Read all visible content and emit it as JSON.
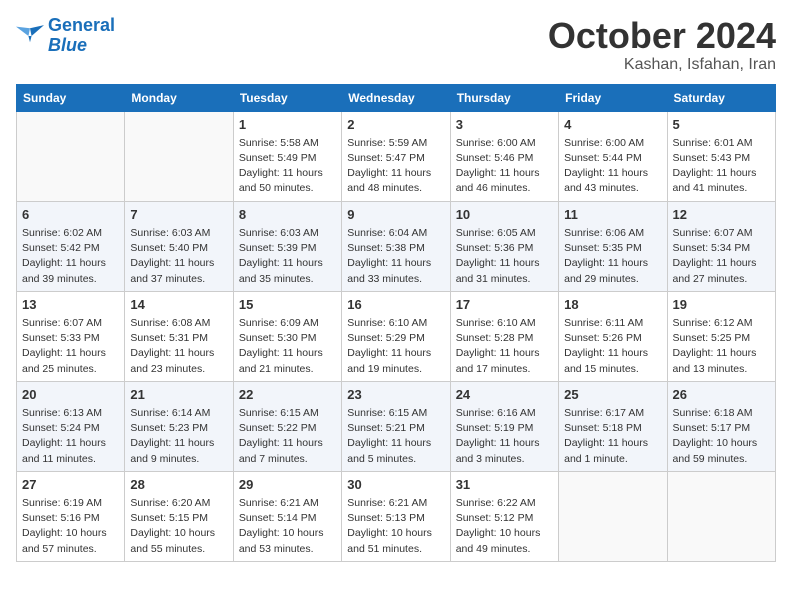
{
  "header": {
    "logo_line1": "General",
    "logo_line2": "Blue",
    "month": "October 2024",
    "location": "Kashan, Isfahan, Iran"
  },
  "weekdays": [
    "Sunday",
    "Monday",
    "Tuesday",
    "Wednesday",
    "Thursday",
    "Friday",
    "Saturday"
  ],
  "weeks": [
    [
      {
        "day": "",
        "info": ""
      },
      {
        "day": "",
        "info": ""
      },
      {
        "day": "1",
        "info": "Sunrise: 5:58 AM\nSunset: 5:49 PM\nDaylight: 11 hours and 50 minutes."
      },
      {
        "day": "2",
        "info": "Sunrise: 5:59 AM\nSunset: 5:47 PM\nDaylight: 11 hours and 48 minutes."
      },
      {
        "day": "3",
        "info": "Sunrise: 6:00 AM\nSunset: 5:46 PM\nDaylight: 11 hours and 46 minutes."
      },
      {
        "day": "4",
        "info": "Sunrise: 6:00 AM\nSunset: 5:44 PM\nDaylight: 11 hours and 43 minutes."
      },
      {
        "day": "5",
        "info": "Sunrise: 6:01 AM\nSunset: 5:43 PM\nDaylight: 11 hours and 41 minutes."
      }
    ],
    [
      {
        "day": "6",
        "info": "Sunrise: 6:02 AM\nSunset: 5:42 PM\nDaylight: 11 hours and 39 minutes."
      },
      {
        "day": "7",
        "info": "Sunrise: 6:03 AM\nSunset: 5:40 PM\nDaylight: 11 hours and 37 minutes."
      },
      {
        "day": "8",
        "info": "Sunrise: 6:03 AM\nSunset: 5:39 PM\nDaylight: 11 hours and 35 minutes."
      },
      {
        "day": "9",
        "info": "Sunrise: 6:04 AM\nSunset: 5:38 PM\nDaylight: 11 hours and 33 minutes."
      },
      {
        "day": "10",
        "info": "Sunrise: 6:05 AM\nSunset: 5:36 PM\nDaylight: 11 hours and 31 minutes."
      },
      {
        "day": "11",
        "info": "Sunrise: 6:06 AM\nSunset: 5:35 PM\nDaylight: 11 hours and 29 minutes."
      },
      {
        "day": "12",
        "info": "Sunrise: 6:07 AM\nSunset: 5:34 PM\nDaylight: 11 hours and 27 minutes."
      }
    ],
    [
      {
        "day": "13",
        "info": "Sunrise: 6:07 AM\nSunset: 5:33 PM\nDaylight: 11 hours and 25 minutes."
      },
      {
        "day": "14",
        "info": "Sunrise: 6:08 AM\nSunset: 5:31 PM\nDaylight: 11 hours and 23 minutes."
      },
      {
        "day": "15",
        "info": "Sunrise: 6:09 AM\nSunset: 5:30 PM\nDaylight: 11 hours and 21 minutes."
      },
      {
        "day": "16",
        "info": "Sunrise: 6:10 AM\nSunset: 5:29 PM\nDaylight: 11 hours and 19 minutes."
      },
      {
        "day": "17",
        "info": "Sunrise: 6:10 AM\nSunset: 5:28 PM\nDaylight: 11 hours and 17 minutes."
      },
      {
        "day": "18",
        "info": "Sunrise: 6:11 AM\nSunset: 5:26 PM\nDaylight: 11 hours and 15 minutes."
      },
      {
        "day": "19",
        "info": "Sunrise: 6:12 AM\nSunset: 5:25 PM\nDaylight: 11 hours and 13 minutes."
      }
    ],
    [
      {
        "day": "20",
        "info": "Sunrise: 6:13 AM\nSunset: 5:24 PM\nDaylight: 11 hours and 11 minutes."
      },
      {
        "day": "21",
        "info": "Sunrise: 6:14 AM\nSunset: 5:23 PM\nDaylight: 11 hours and 9 minutes."
      },
      {
        "day": "22",
        "info": "Sunrise: 6:15 AM\nSunset: 5:22 PM\nDaylight: 11 hours and 7 minutes."
      },
      {
        "day": "23",
        "info": "Sunrise: 6:15 AM\nSunset: 5:21 PM\nDaylight: 11 hours and 5 minutes."
      },
      {
        "day": "24",
        "info": "Sunrise: 6:16 AM\nSunset: 5:19 PM\nDaylight: 11 hours and 3 minutes."
      },
      {
        "day": "25",
        "info": "Sunrise: 6:17 AM\nSunset: 5:18 PM\nDaylight: 11 hours and 1 minute."
      },
      {
        "day": "26",
        "info": "Sunrise: 6:18 AM\nSunset: 5:17 PM\nDaylight: 10 hours and 59 minutes."
      }
    ],
    [
      {
        "day": "27",
        "info": "Sunrise: 6:19 AM\nSunset: 5:16 PM\nDaylight: 10 hours and 57 minutes."
      },
      {
        "day": "28",
        "info": "Sunrise: 6:20 AM\nSunset: 5:15 PM\nDaylight: 10 hours and 55 minutes."
      },
      {
        "day": "29",
        "info": "Sunrise: 6:21 AM\nSunset: 5:14 PM\nDaylight: 10 hours and 53 minutes."
      },
      {
        "day": "30",
        "info": "Sunrise: 6:21 AM\nSunset: 5:13 PM\nDaylight: 10 hours and 51 minutes."
      },
      {
        "day": "31",
        "info": "Sunrise: 6:22 AM\nSunset: 5:12 PM\nDaylight: 10 hours and 49 minutes."
      },
      {
        "day": "",
        "info": ""
      },
      {
        "day": "",
        "info": ""
      }
    ]
  ]
}
